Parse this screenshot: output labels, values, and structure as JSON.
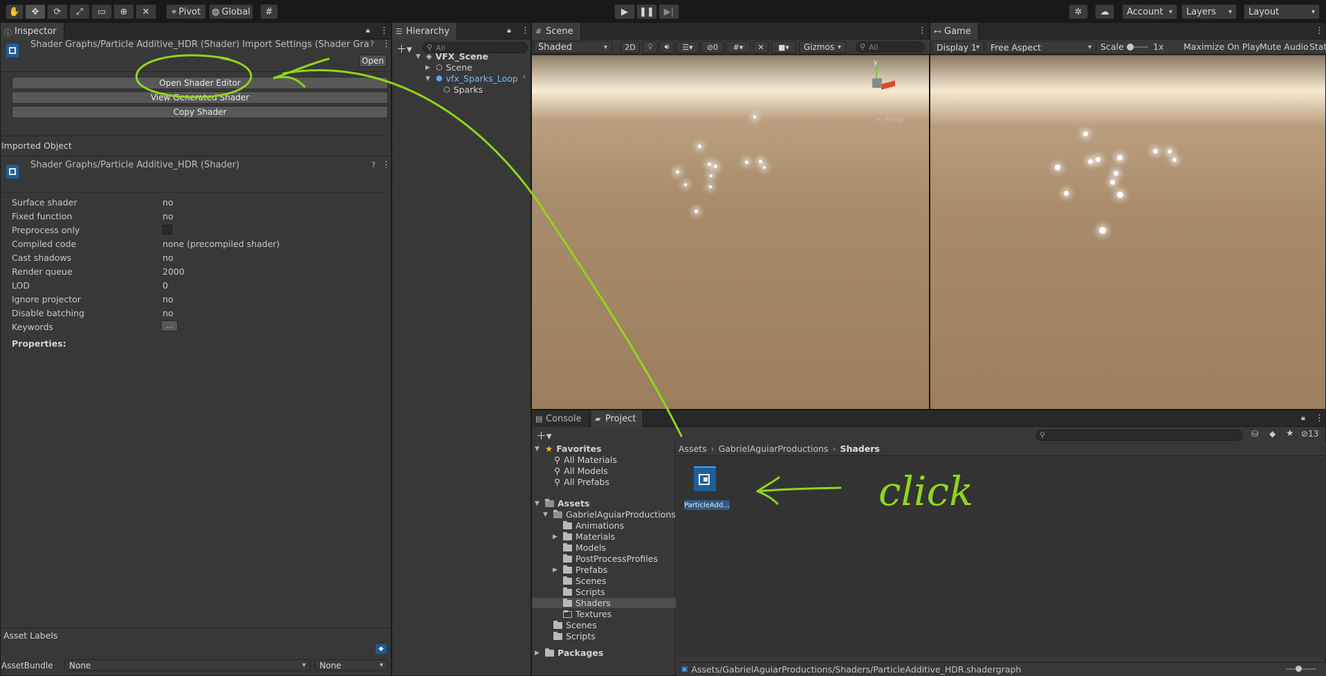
{
  "toolbar": {
    "pivot_label": "Pivot",
    "global_label": "Global",
    "account_label": "Account",
    "layers_label": "Layers",
    "layout_label": "Layout"
  },
  "inspector": {
    "tab_label": "Inspector",
    "header_title": "Shader Graphs/Particle Additive_HDR (Shader) Import Settings (Shader Graph",
    "open_label": "Open",
    "buttons": [
      "Open Shader Editor",
      "View Generated Shader",
      "Copy Shader"
    ],
    "imported_object_label": "Imported Object",
    "object_title": "Shader Graphs/Particle Additive_HDR (Shader)",
    "properties": [
      {
        "label": "Surface shader",
        "value": "no"
      },
      {
        "label": "Fixed function",
        "value": "no"
      },
      {
        "label": "Preprocess only",
        "value": ""
      },
      {
        "label": "Compiled code",
        "value": "none (precompiled shader)"
      },
      {
        "label": "Cast shadows",
        "value": "no"
      },
      {
        "label": "Render queue",
        "value": "2000"
      },
      {
        "label": "LOD",
        "value": "0"
      },
      {
        "label": "Ignore projector",
        "value": "no"
      },
      {
        "label": "Disable batching",
        "value": "no"
      },
      {
        "label": "Keywords",
        "value": "..."
      }
    ],
    "properties_heading": "Properties:",
    "asset_labels": "Asset Labels",
    "assetbundle_label": "AssetBundle",
    "assetbundle_value": "None",
    "assetbundle_variant": "None"
  },
  "hierarchy": {
    "tab_label": "Hierarchy",
    "search_placeholder": "All",
    "items": [
      "VFX_Scene",
      "Scene",
      "vfx_Sparks_Loop",
      "Sparks"
    ]
  },
  "scene": {
    "tab_label": "Scene",
    "shading": "Shaded",
    "mode_2d": "2D",
    "hidden_count": "0",
    "gizmos_label": "Gizmos",
    "search_placeholder": "All",
    "axis_y": "y",
    "persp_label": "< Persp"
  },
  "game": {
    "tab_label": "Game",
    "display": "Display 1",
    "aspect": "Free Aspect",
    "scale_label": "Scale",
    "scale_value": "1x",
    "maximize": "Maximize On Play",
    "mute": "Mute Audio",
    "stats": "Stat"
  },
  "console": {
    "tab_label": "Console"
  },
  "project": {
    "tab_label": "Project",
    "hidden_count": "13",
    "favorites_label": "Favorites",
    "favorites": [
      "All Materials",
      "All Models",
      "All Prefabs"
    ],
    "assets_label": "Assets",
    "tree": [
      {
        "label": "GabrielAguiarProductions",
        "depth": 1,
        "arrow": "▼"
      },
      {
        "label": "Animations",
        "depth": 2,
        "arrow": ""
      },
      {
        "label": "Materials",
        "depth": 2,
        "arrow": "▶"
      },
      {
        "label": "Models",
        "depth": 2,
        "arrow": ""
      },
      {
        "label": "PostProcessProfiles",
        "depth": 2,
        "arrow": ""
      },
      {
        "label": "Prefabs",
        "depth": 2,
        "arrow": "▶"
      },
      {
        "label": "Scenes",
        "depth": 2,
        "arrow": ""
      },
      {
        "label": "Scripts",
        "depth": 2,
        "arrow": ""
      },
      {
        "label": "Shaders",
        "depth": 2,
        "arrow": "",
        "selected": true
      },
      {
        "label": "Textures",
        "depth": 2,
        "arrow": "",
        "empty": true
      },
      {
        "label": "Scenes",
        "depth": 1,
        "arrow": ""
      },
      {
        "label": "Scripts",
        "depth": 1,
        "arrow": ""
      }
    ],
    "packages_label": "Packages",
    "breadcrumb": [
      "Assets",
      "GabrielAguiarProductions",
      "Shaders"
    ],
    "asset_name": "ParticleAdd...",
    "status_path": "Assets/GabrielAguiarProductions/Shaders/ParticleAdditive_HDR.shadergraph"
  },
  "annotation": {
    "text": "click",
    "color": "#8fd619"
  }
}
